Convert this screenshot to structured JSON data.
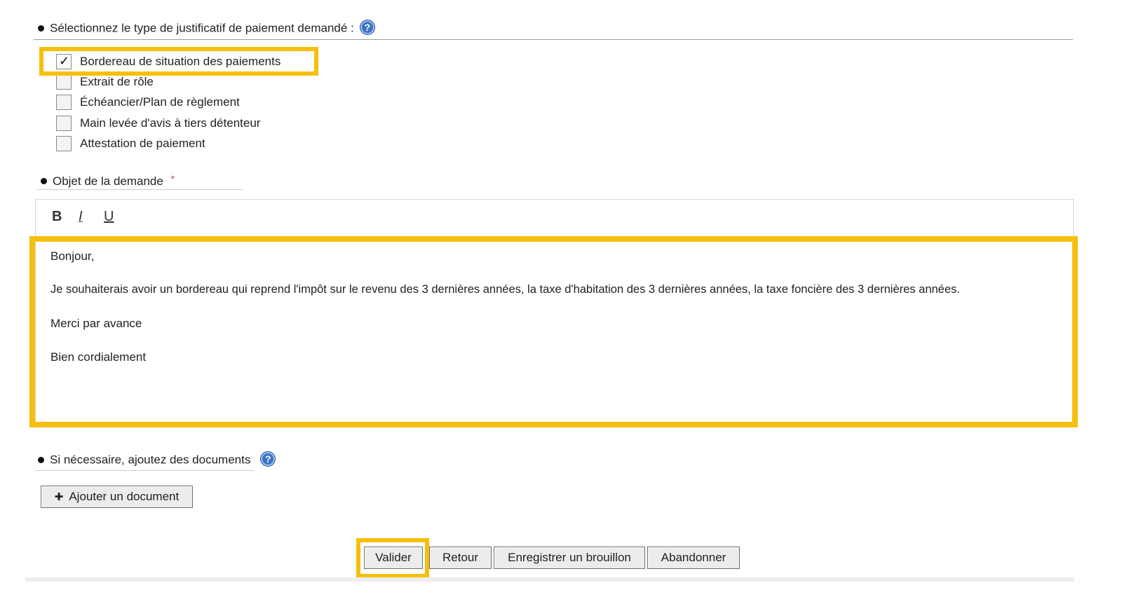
{
  "payment_section": {
    "title": "Sélectionnez le type de justificatif de paiement demandé :",
    "help_icon": "?",
    "options": [
      {
        "label": "Bordereau de situation des paiements",
        "checked": true
      },
      {
        "label": "Extrait de rôle",
        "checked": false
      },
      {
        "label": "Échéancier/Plan de règlement",
        "checked": false
      },
      {
        "label": "Main levée d'avis à tiers détenteur",
        "checked": false
      },
      {
        "label": "Attestation de paiement",
        "checked": false
      }
    ],
    "check_mark": "✓"
  },
  "subject_section": {
    "title": "Objet de la demande",
    "required_mark": "*",
    "toolbar": {
      "bold": "B",
      "italic": "I",
      "underline": "U"
    },
    "message_lines": [
      "Bonjour,",
      "Je souhaiterais avoir un bordereau qui reprend l'impôt sur le revenu des 3 dernières années, la taxe d'habitation des 3 dernières années, la taxe foncière des 3 dernières années.",
      "Merci par avance",
      "Bien cordialement"
    ]
  },
  "documents_section": {
    "title": "Si nécessaire, ajoutez des documents",
    "help_icon": "?",
    "add_button": {
      "icon": "✚",
      "label": "Ajouter un document"
    }
  },
  "actions": {
    "validate": "Valider",
    "back": "Retour",
    "save_draft": "Enregistrer un brouillon",
    "abandon": "Abandonner"
  },
  "colors": {
    "highlight": "#f6bf0e",
    "help_icon": "#3b73c4"
  }
}
